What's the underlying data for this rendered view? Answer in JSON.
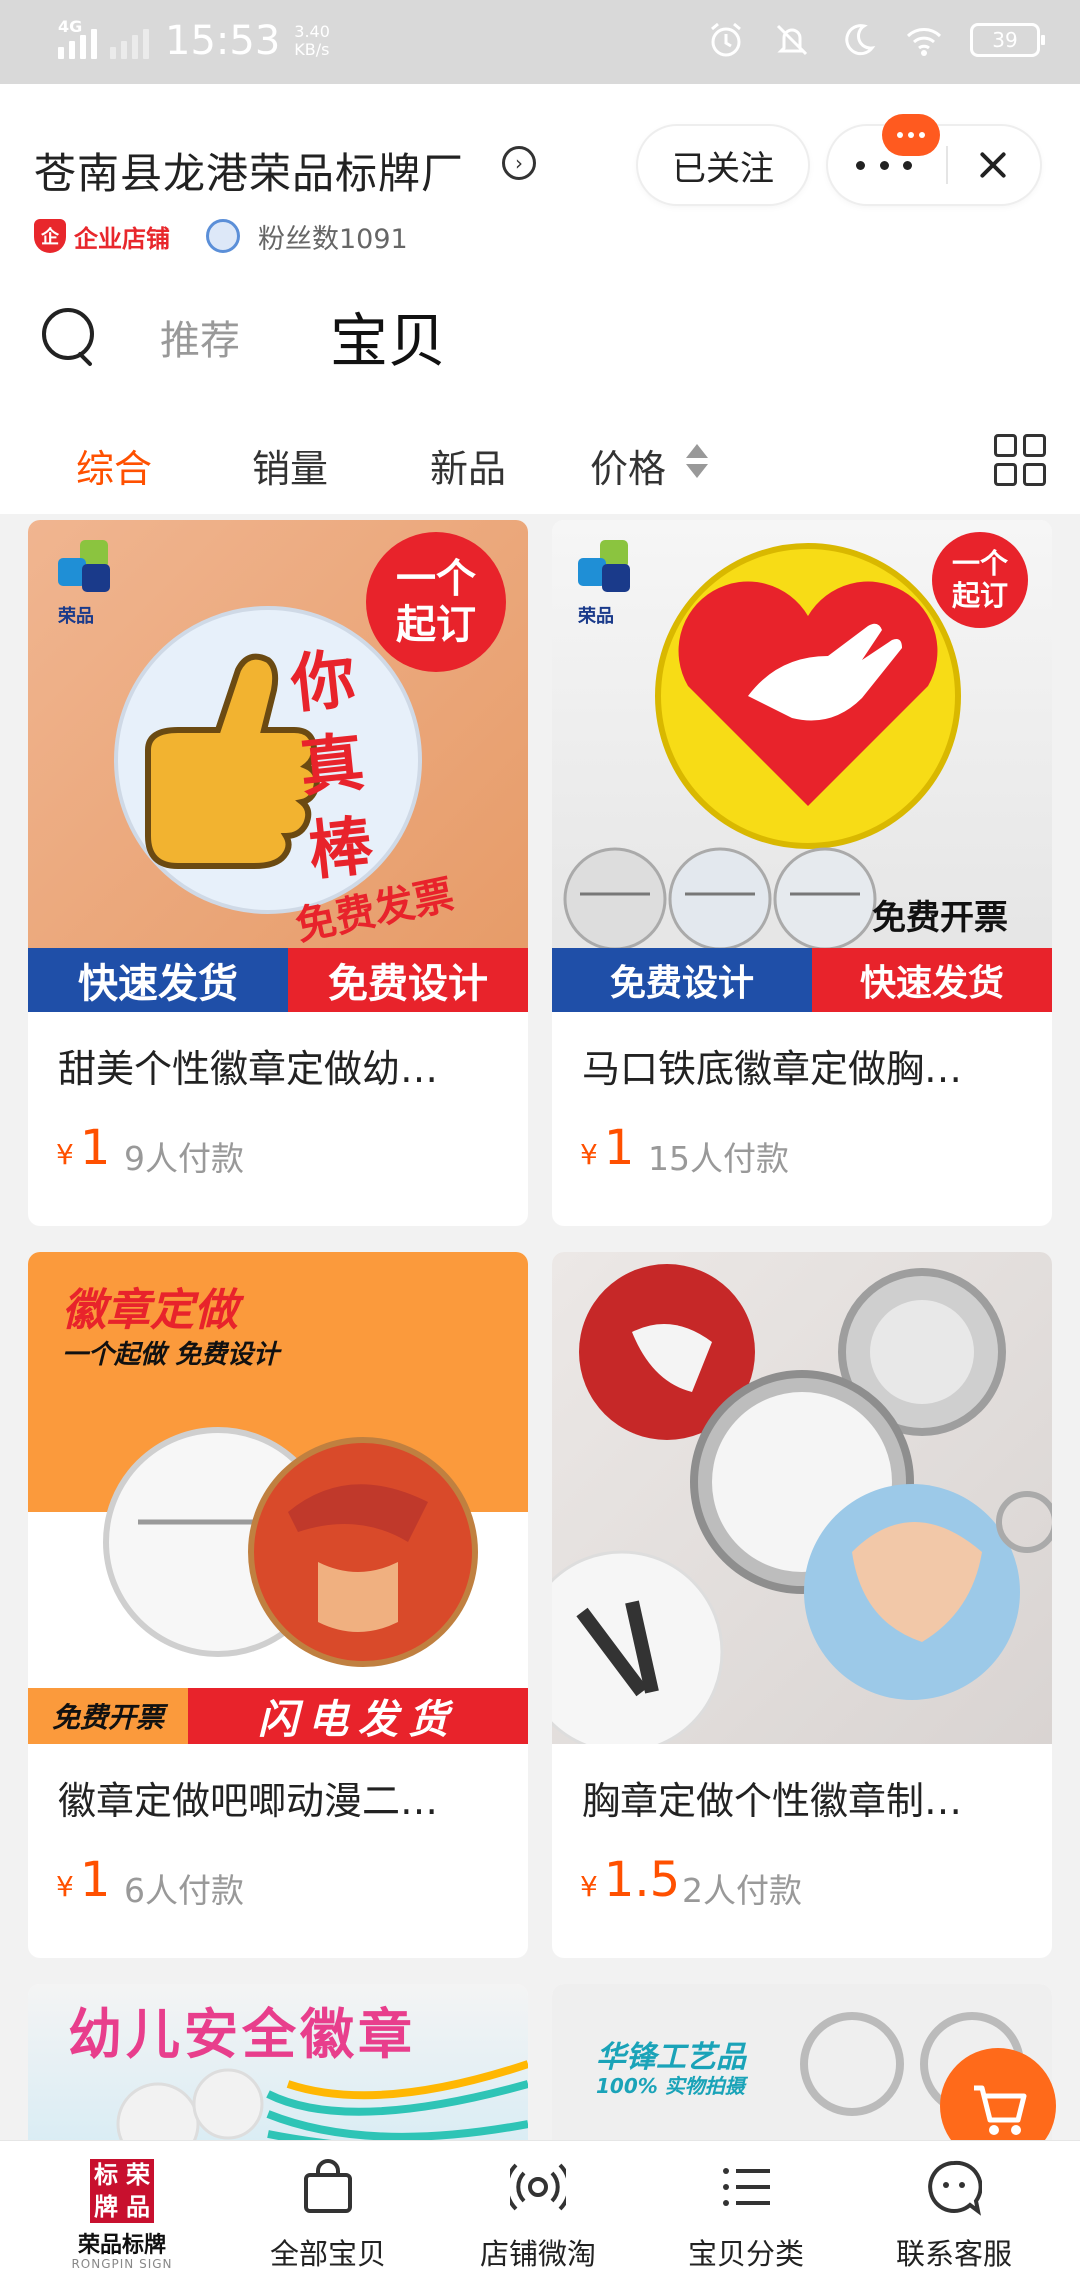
{
  "status_bar": {
    "network": "4G",
    "time": "15:53",
    "speed_value": "3.40",
    "speed_unit": "KB/s",
    "battery": "39"
  },
  "shop": {
    "name": "苍南县龙港荣品标牌厂",
    "follow_label": "已关注",
    "enterprise_label": "企业店铺",
    "fans_label": "粉丝数1091"
  },
  "tabs": {
    "recommend": "推荐",
    "items": "宝贝"
  },
  "sort": {
    "overall": "综合",
    "sales": "销量",
    "new": "新品",
    "price": "价格"
  },
  "products": [
    {
      "title": "甜美个性徽章定做幼…",
      "yen": "¥",
      "price": "1",
      "sold": "9人付款",
      "image_text": {
        "badge": "一个起订",
        "slogan_1": "你",
        "slogan_2": "真",
        "slogan_3": "棒",
        "invoice": "免费发票",
        "ribbon_left": "快速发货",
        "ribbon_right": "免费设计",
        "logo": "荣品"
      }
    },
    {
      "title": "马口铁底徽章定做胸…",
      "yen": "¥",
      "price": "1",
      "sold": "15人付款",
      "image_text": {
        "badge": "一个起订",
        "invoice": "免费开票",
        "ribbon_left": "免费设计",
        "ribbon_right": "快速发货",
        "logo": "荣品"
      }
    },
    {
      "title": "徽章定做吧唧动漫二…",
      "yen": "¥",
      "price": "1",
      "sold": "6人付款",
      "image_text": {
        "headline": "徽章定做",
        "subline": "一个起做 免费设计",
        "ribbon_left": "免费开票",
        "ribbon_right": "闪电发货"
      }
    },
    {
      "title": "胸章定做个性徽章制…",
      "yen": "¥",
      "price": "1.5",
      "sold": "2人付款",
      "image_text": {}
    },
    {
      "title": "",
      "image_text": {
        "headline": "幼儿安全徽章"
      }
    },
    {
      "title": "",
      "image_text": {
        "headline": "华锋工艺品",
        "subline": "100% 实物拍摄"
      }
    }
  ],
  "bottom_nav": {
    "logo_chars": [
      "标",
      "荣",
      "牌",
      "品"
    ],
    "logo_name": "荣品标牌",
    "logo_sub": "RONGPIN SIGN",
    "all_items": "全部宝贝",
    "weitao": "店铺微淘",
    "categories": "宝贝分类",
    "service": "联系客服"
  },
  "colors": {
    "accent": "#ff5000",
    "status_bar": "#d9d9d9",
    "ribbon_red": "#e8232b",
    "ribbon_blue": "#1f4fa8"
  }
}
